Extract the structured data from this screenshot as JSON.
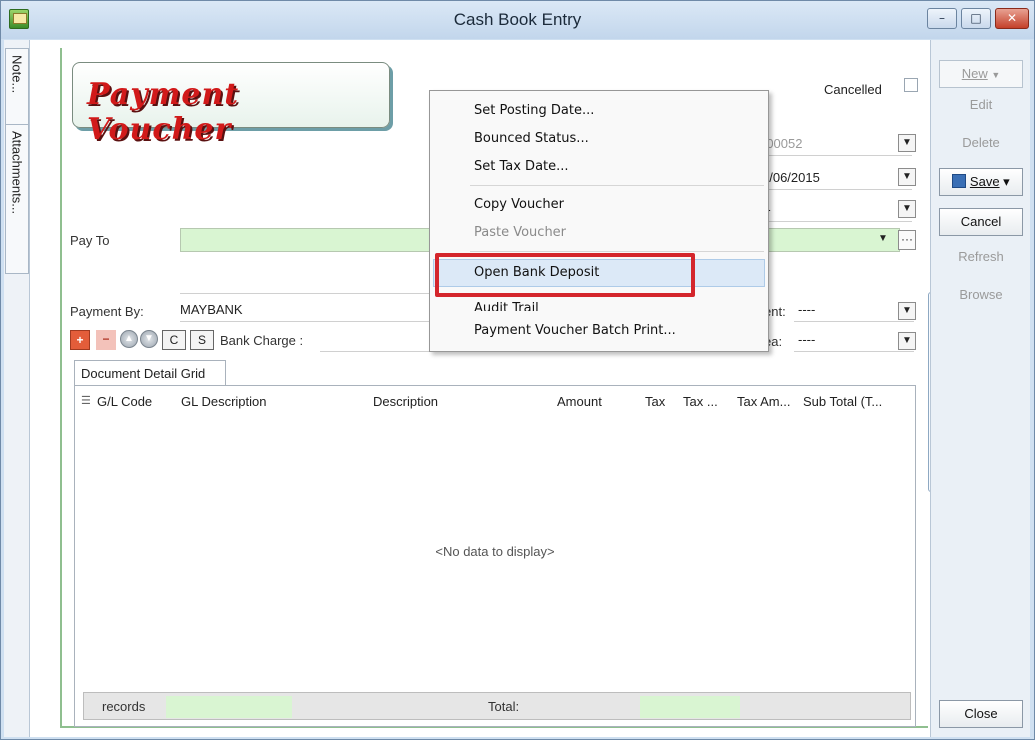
{
  "window": {
    "title": "Cash Book Entry",
    "minimize": "–",
    "maximize": "□",
    "close": "✕"
  },
  "side_tabs": {
    "notes": "Note...",
    "attachments": "Attachments..."
  },
  "header": {
    "logo_text": "Payment Voucher",
    "cancelled_label": "Cancelled"
  },
  "fields": {
    "doc_no_value": "-00052",
    "date_value": "6/06/2015",
    "third_value": "--",
    "pay_to_label": "Pay To",
    "payment_by_label": "Payment By:",
    "payment_by_value": "MAYBANK",
    "bank_charge_label": "Bank Charge :",
    "agent_label": "ent:",
    "agent_value": "----",
    "area_label": "ea:",
    "area_value": "----"
  },
  "toolbar": {
    "c_label": "C",
    "s_label": "S",
    "add": "+",
    "remove": "−",
    "up": "▲",
    "down": "▼"
  },
  "grid": {
    "tab_label": "Document Detail Grid",
    "columns": [
      "G/L Code",
      "GL Description",
      "Description",
      "Amount",
      "Tax",
      "Tax ...",
      "Tax Am...",
      "Sub Total (T..."
    ],
    "no_data": "<No data to display>",
    "records_label": "records",
    "total_label": "Total:"
  },
  "right_buttons": {
    "new": "New",
    "edit": "Edit",
    "delete": "Delete",
    "save": "Save",
    "cancel": "Cancel",
    "refresh": "Refresh",
    "browse": "Browse",
    "close": "Close"
  },
  "context_menu": {
    "items": [
      "Set Posting Date...",
      "Bounced Status...",
      "Set Tax Date...",
      "Copy Voucher",
      "Paste Voucher",
      "Open Bank Deposit",
      "Audit Trail",
      "Payment Voucher Batch Print..."
    ]
  },
  "colors": {
    "highlight_box": "#d4262c",
    "input_green": "#d9f5d2",
    "logo_red": "#d11a1a"
  }
}
